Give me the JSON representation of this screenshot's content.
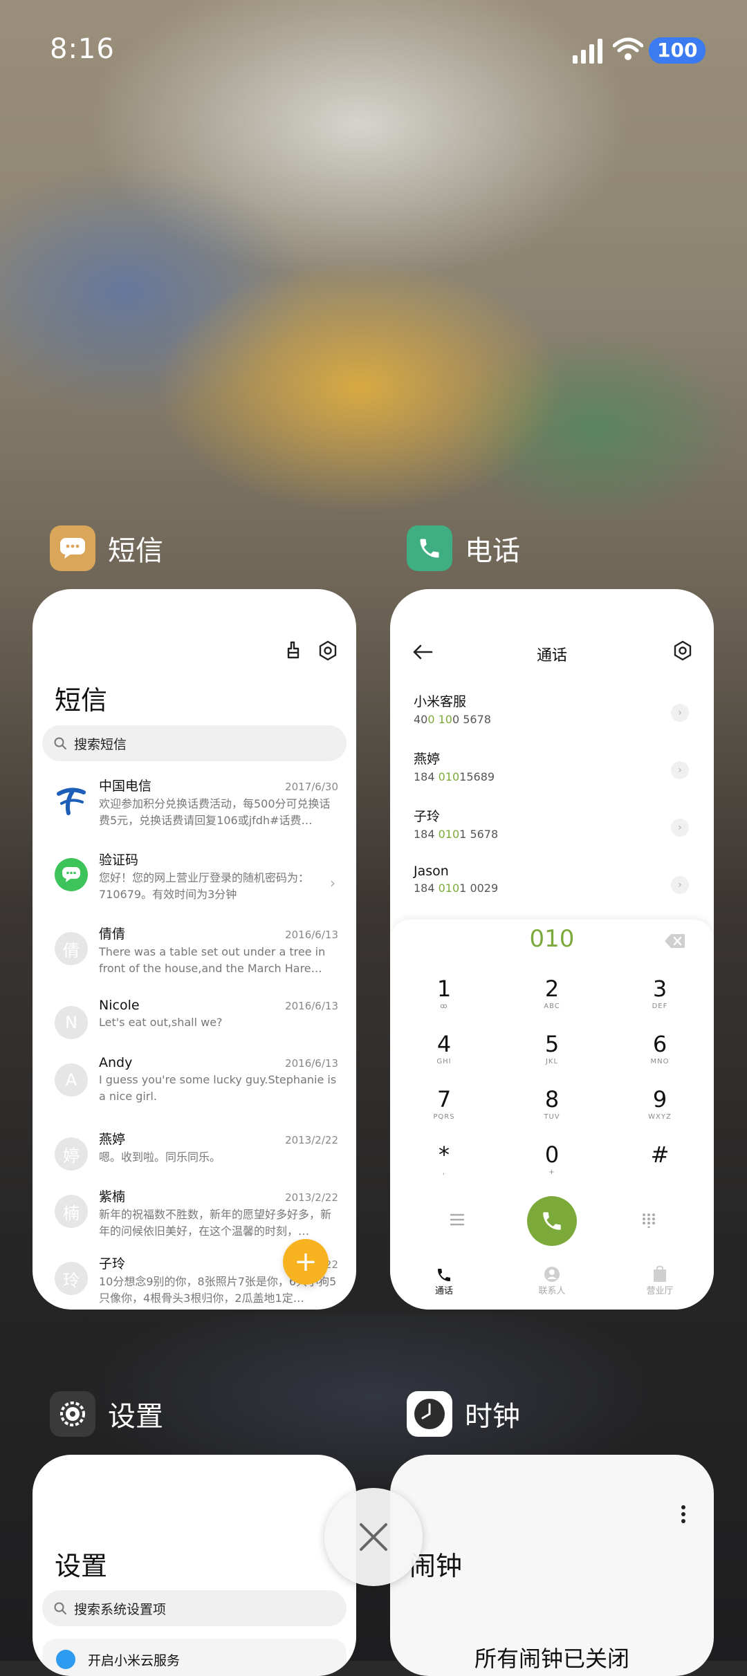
{
  "status_bar": {
    "time": "8:16",
    "battery": "100"
  },
  "apps": {
    "sms": {
      "label": "短信",
      "title": "短信",
      "search_placeholder": "搜索短信",
      "messages": [
        {
          "avatar": "",
          "name": "中国电信",
          "date": "2017/6/30",
          "text": "欢迎参加积分兑换话费活动，每500分可兑换话费5元，兑换话费请回复106或jfdh#话费…"
        },
        {
          "avatar": "",
          "name": "验证码",
          "date": "",
          "text": "您好！您的网上营业厅登录的随机密码为：710679。有效时间为3分钟"
        },
        {
          "avatar": "倩",
          "name": "倩倩",
          "date": "2016/6/13",
          "text": "There was a table set out under a tree in front of the house,and the March Hare an…"
        },
        {
          "avatar": "N",
          "name": "Nicole",
          "date": "2016/6/13",
          "text": "Let's eat out,shall we?"
        },
        {
          "avatar": "A",
          "name": "Andy",
          "date": "2016/6/13",
          "text": "I guess you're some lucky guy.Stephanie is a nice girl."
        },
        {
          "avatar": "婷",
          "name": "燕婷",
          "date": "2013/2/22",
          "text": "嗯。收到啦。同乐同乐。"
        },
        {
          "avatar": "楠",
          "name": "紫楠",
          "date": "2013/2/22",
          "text": "新年的祝福数不胜数，新年的愿望好多好多，新年的问候依旧美好，在这个温馨的时刻，…"
        },
        {
          "avatar": "玲",
          "name": "子玲",
          "date": "2013/2/22",
          "text": "10分想念9别的你，8张照片7张是你，6只小狗5只像你，4根骨头3根归你，2瓜盖地1定…"
        }
      ],
      "fab": "+"
    },
    "phone": {
      "label": "电话",
      "title": "通话",
      "calls": [
        {
          "name": "小米客服",
          "num_pre": "40",
          "num_hl": "0 10",
          "num_post": "0 5678"
        },
        {
          "name": "燕婷",
          "num_pre": "184 ",
          "num_hl": "010",
          "num_post": "15689"
        },
        {
          "name": "子玲",
          "num_pre": "184 ",
          "num_hl": "010",
          "num_post": "1 5678"
        },
        {
          "name": "Jason",
          "num_pre": "184 ",
          "num_hl": "010",
          "num_post": "1 0029"
        }
      ],
      "dial_input": "010",
      "keys": [
        [
          {
            "d": "1",
            "l": "ꝏ"
          },
          {
            "d": "2",
            "l": "ABC"
          },
          {
            "d": "3",
            "l": "DEF"
          }
        ],
        [
          {
            "d": "4",
            "l": "GHI"
          },
          {
            "d": "5",
            "l": "JKL"
          },
          {
            "d": "6",
            "l": "MNO"
          }
        ],
        [
          {
            "d": "7",
            "l": "PQRS"
          },
          {
            "d": "8",
            "l": "TUV"
          },
          {
            "d": "9",
            "l": "WXYZ"
          }
        ],
        [
          {
            "d": "*",
            "l": ","
          },
          {
            "d": "0",
            "l": "+"
          },
          {
            "d": "#",
            "l": ""
          }
        ]
      ],
      "nav": {
        "calls": "通话",
        "contacts": "联系人",
        "hall": "营业厅"
      }
    },
    "settings": {
      "label": "设置",
      "title": "设置",
      "search_placeholder": "搜索系统设置项",
      "first_item": "开启小米云服务"
    },
    "clock": {
      "label": "时钟",
      "title": "闹钟",
      "empty_text": "所有闹钟已关闭"
    }
  },
  "colors": {
    "accent_green": "#7caa3a",
    "fab_orange": "#f7b21f",
    "battery_blue": "#3b7bf2",
    "sms_icon": "#d9a65a",
    "phone_icon": "#3fae82"
  },
  "icons": [
    "signal-icon",
    "wifi-icon",
    "battery-icon",
    "brush-icon",
    "settings-gear-icon",
    "search-icon",
    "back-arrow-icon",
    "chevron-right-icon",
    "backspace-icon",
    "menu-icon",
    "dialpad-icon",
    "phone-icon",
    "contacts-icon",
    "store-icon",
    "more-icon",
    "close-icon"
  ]
}
